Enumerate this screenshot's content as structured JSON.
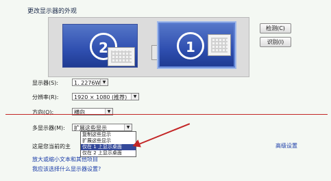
{
  "header": {
    "title": "更改显示器的外观"
  },
  "preview": {
    "monitor_2_label": "2",
    "monitor_1_label": "1"
  },
  "buttons": {
    "detect": "检测(C)",
    "identify": "识别(I)"
  },
  "form": {
    "display_label": "显示器(S):",
    "display_value": "1. 2276W",
    "resolution_label": "分辨率(R):",
    "resolution_value": "1920 × 1080 (推荐)",
    "orientation_label": "方向(O):",
    "orientation_value": "横向",
    "multi_label": "多显示器(M):",
    "multi_value": "扩展这些显示"
  },
  "multi_dropdown": {
    "options": [
      "复制这些显示",
      "扩展这些显示",
      "仅在 1 上显示桌面",
      "仅在 2 上显示桌面"
    ],
    "selected_index": 2
  },
  "info_text": "这是您当前的主",
  "links": {
    "advanced": "高级设置",
    "enlarge": "放大或缩小文本和其他项目",
    "which": "我应该选择什么显示器设置?"
  },
  "colors": {
    "annotation": "#c32525",
    "selection": "#33489a"
  }
}
